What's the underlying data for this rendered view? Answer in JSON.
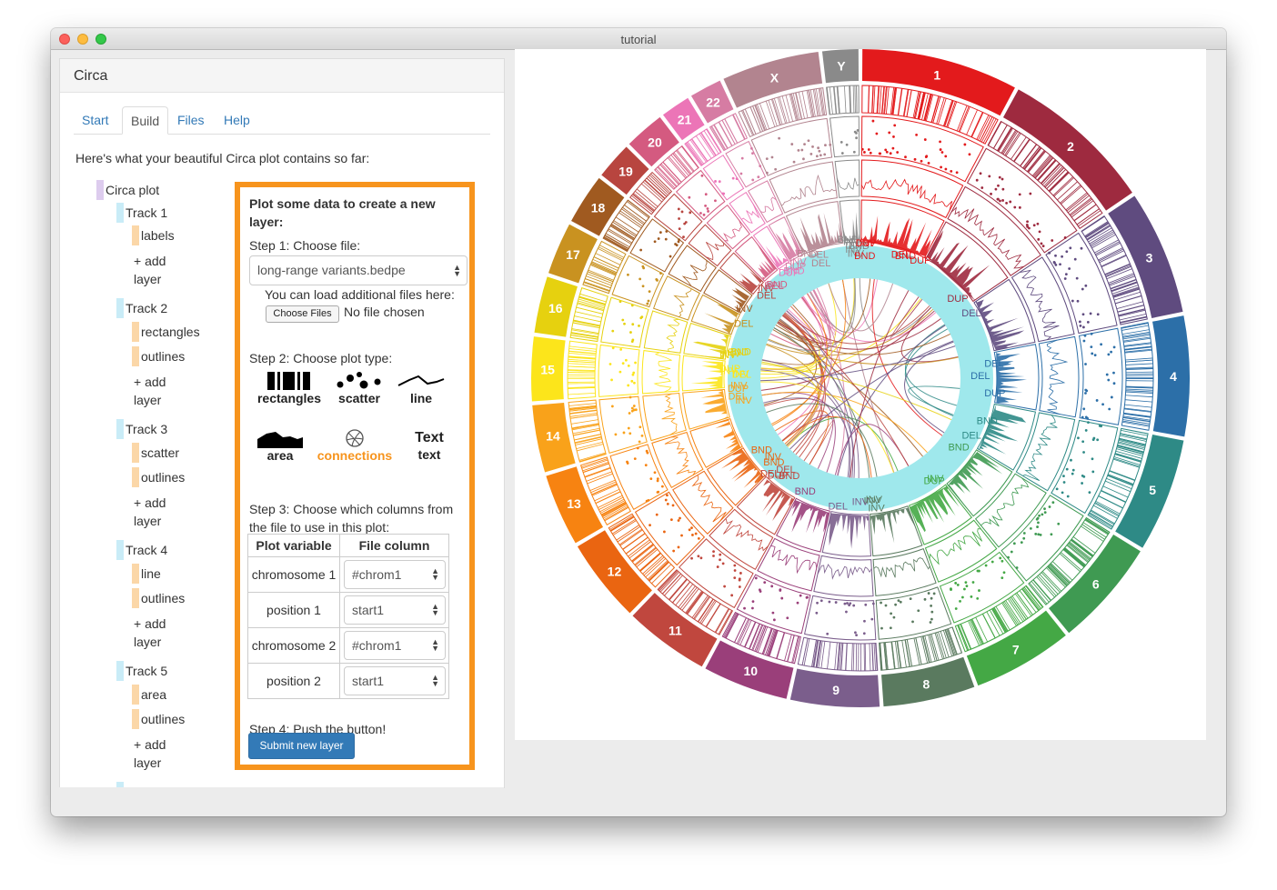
{
  "window": {
    "title": "tutorial"
  },
  "sidebar": {
    "title": "Circa",
    "tabs": [
      {
        "label": "Start",
        "active": false
      },
      {
        "label": "Build",
        "active": true
      },
      {
        "label": "Files",
        "active": false
      },
      {
        "label": "Help",
        "active": false
      }
    ],
    "intro": "Here's what your beautiful Circa plot contains so far:",
    "tree": {
      "root": "Circa plot",
      "tracks": [
        {
          "label": "Track 1",
          "layers": [
            "labels"
          ],
          "add": [
            "+ add",
            "layer"
          ]
        },
        {
          "label": "Track 2",
          "layers": [
            "rectangles",
            "outlines"
          ],
          "add": [
            "+ add",
            "layer"
          ]
        },
        {
          "label": "Track 3",
          "layers": [
            "scatter",
            "outlines"
          ],
          "add": [
            "+ add",
            "layer"
          ]
        },
        {
          "label": "Track 4",
          "layers": [
            "line",
            "outlines"
          ],
          "add": [
            "+ add",
            "layer"
          ]
        },
        {
          "label": "Track 5",
          "layers": [
            "area",
            "outlines"
          ],
          "add": [
            "+ add",
            "layer"
          ]
        }
      ]
    }
  },
  "new_layer": {
    "heading_1": "Plot some data to create a new",
    "heading_2": "layer:",
    "step1": "Step 1: Choose file:",
    "file_select": "long-range variants.bedpe",
    "load_hint": "You can load additional files here:",
    "choose_files": "Choose Files",
    "no_file": "No file chosen",
    "step2": "Step 2: Choose plot type:",
    "plot_types": [
      {
        "label": "rectangles",
        "icon": "rectangles-icon",
        "selected": false
      },
      {
        "label": "scatter",
        "icon": "scatter-icon",
        "selected": false
      },
      {
        "label": "line",
        "icon": "line-icon",
        "selected": false
      },
      {
        "label": "area",
        "icon": "area-icon",
        "selected": false
      },
      {
        "label": "connections",
        "icon": "connections-icon",
        "selected": true
      },
      {
        "label": "text",
        "icon_text": "Text",
        "selected": false
      }
    ],
    "step3_1": "Step 3: Choose which columns from",
    "step3_2": "the file to use in this plot:",
    "table_headers": [
      "Plot variable",
      "File column"
    ],
    "table_rows": [
      {
        "variable": "chromosome 1",
        "column": "#chrom1"
      },
      {
        "variable": "position 1",
        "column": "start1"
      },
      {
        "variable": "chromosome 2",
        "column": "#chrom1"
      },
      {
        "variable": "position 2",
        "column": "start1"
      }
    ],
    "step4": "Step 4: Push the button!",
    "submit": "Submit new layer"
  },
  "colors": {
    "accent_box": "#f7941d",
    "primary_button": "#337ab7",
    "selected_type": "#f7941d"
  },
  "circos": {
    "chromosomes": [
      {
        "label": "1",
        "color": "#e31a1c",
        "size": 249
      },
      {
        "label": "2",
        "color": "#9e2a3f",
        "size": 243
      },
      {
        "label": "3",
        "color": "#5f4b7f",
        "size": 198
      },
      {
        "label": "4",
        "color": "#2c6fa8",
        "size": 191
      },
      {
        "label": "5",
        "color": "#2e8a86",
        "size": 181
      },
      {
        "label": "6",
        "color": "#3f9a52",
        "size": 171
      },
      {
        "label": "7",
        "color": "#44a845",
        "size": 159
      },
      {
        "label": "8",
        "color": "#5a7a5f",
        "size": 146
      },
      {
        "label": "9",
        "color": "#7b5e8c",
        "size": 141
      },
      {
        "label": "10",
        "color": "#9a3f7a",
        "size": 136
      },
      {
        "label": "11",
        "color": "#c0473e",
        "size": 135
      },
      {
        "label": "12",
        "color": "#ea6511",
        "size": 133
      },
      {
        "label": "13",
        "color": "#f78311",
        "size": 115
      },
      {
        "label": "14",
        "color": "#f9a21a",
        "size": 107
      },
      {
        "label": "15",
        "color": "#fce51b",
        "size": 102
      },
      {
        "label": "16",
        "color": "#e6d10f",
        "size": 90
      },
      {
        "label": "17",
        "color": "#c99220",
        "size": 83
      },
      {
        "label": "18",
        "color": "#a05a20",
        "size": 80
      },
      {
        "label": "19",
        "color": "#b8453f",
        "size": 59
      },
      {
        "label": "20",
        "color": "#d45a80",
        "size": 64
      },
      {
        "label": "21",
        "color": "#ec75b7",
        "size": 47
      },
      {
        "label": "22",
        "color": "#d67ca3",
        "size": 51
      },
      {
        "label": "X",
        "color": "#b2848f",
        "size": 155
      },
      {
        "label": "Y",
        "color": "#8a8a8a",
        "size": 57
      }
    ],
    "sv_labels": [
      "DEL",
      "BND",
      "DUP",
      "INV"
    ]
  }
}
